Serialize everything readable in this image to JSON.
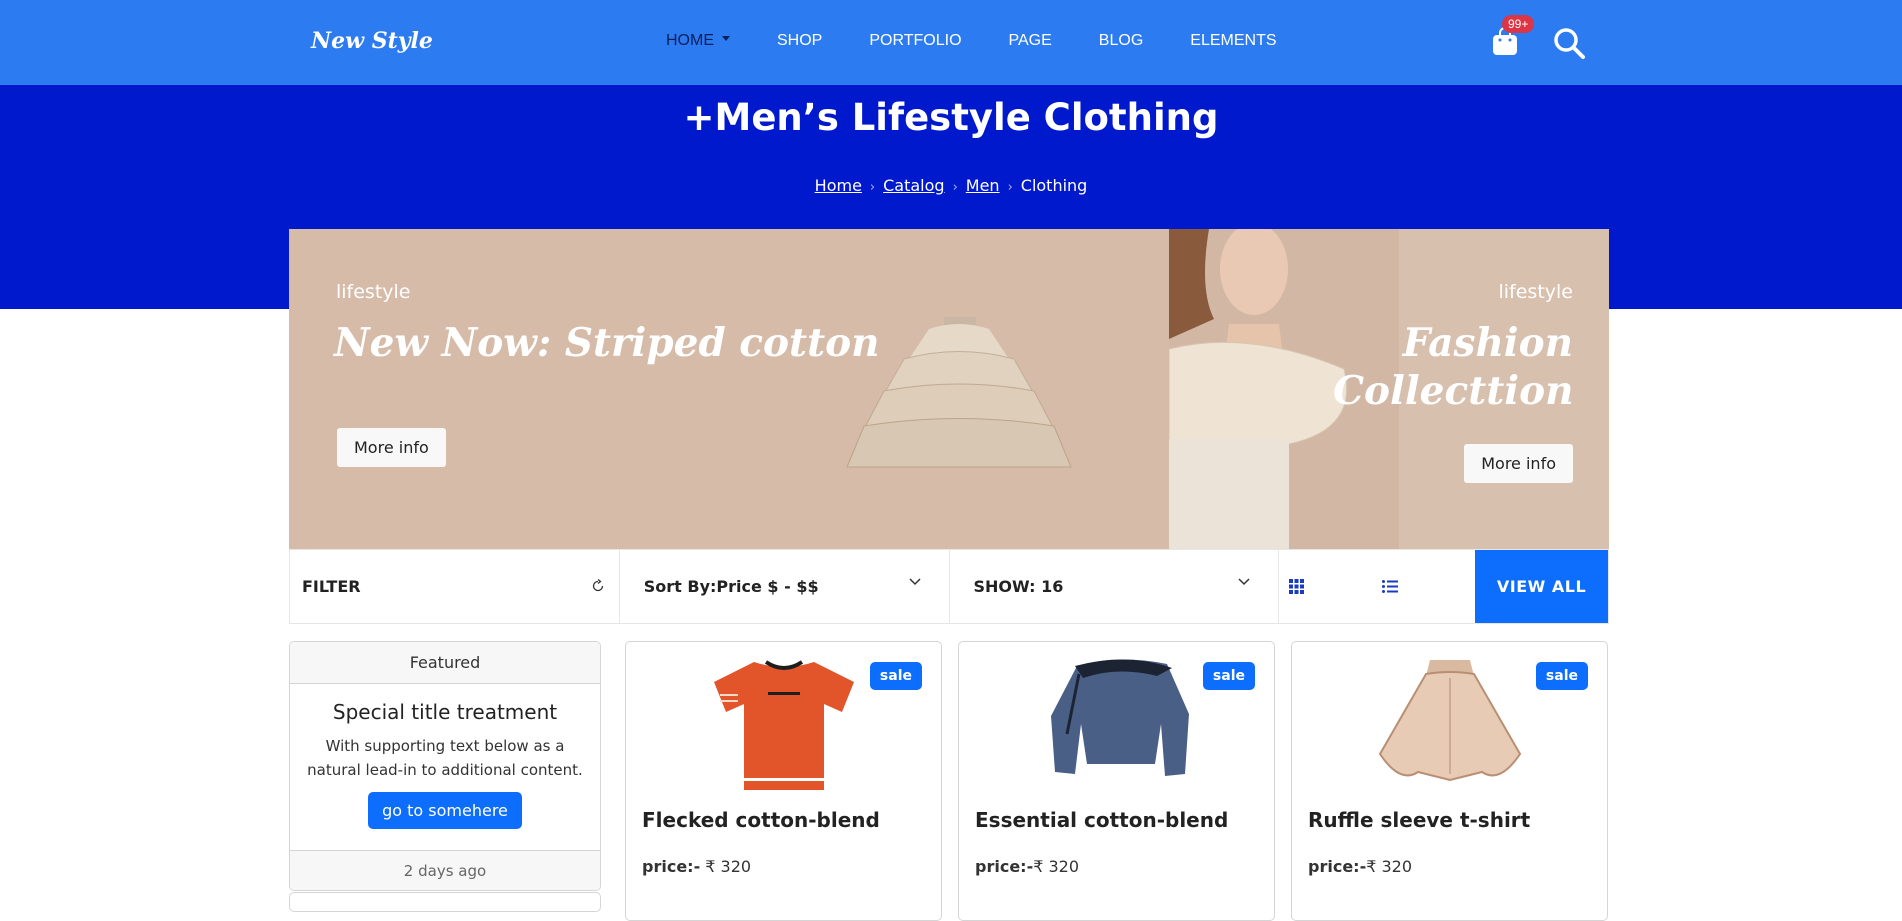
{
  "nav": {
    "brand": "New Style",
    "items": [
      {
        "label": "HOME"
      },
      {
        "label": "SHOP"
      },
      {
        "label": "PORTFOLIO"
      },
      {
        "label": "PAGE"
      },
      {
        "label": "BLOG"
      },
      {
        "label": "ELEMENTS"
      }
    ],
    "cart_badge": "99+"
  },
  "hero": {
    "title": "+Men’s Lifestyle Clothing",
    "breadcrumb": [
      "Home",
      "Catalog",
      "Men",
      "Clothing"
    ]
  },
  "banners": [
    {
      "kicker": "lifestyle",
      "heading": "New Now: Striped cotton",
      "button": "More info"
    },
    {
      "kicker": "lifestyle",
      "heading": "Fashion Collecttion",
      "button": "More info"
    }
  ],
  "toolbar": {
    "filter": "FILTER",
    "sort": "Sort By:Price $ - $$",
    "show": "SHOW: 16",
    "view_all": "VIEW ALL"
  },
  "card": {
    "header": "Featured",
    "title": "Special title treatment",
    "text": "With supporting text below as a natural lead-in to additional content.",
    "button": "go to somehere",
    "footer": "2 days ago"
  },
  "products": [
    {
      "badge": "sale",
      "name": "Flecked cotton-blend",
      "price_label": "price:-",
      "price": " ₹ 320"
    },
    {
      "badge": "sale",
      "name": "Essential cotton-blend",
      "price_label": "price:-",
      "price": "₹ 320"
    },
    {
      "badge": "sale",
      "name": "Ruffle sleeve t-shirt",
      "price_label": "price:-",
      "price": "₹ 320"
    }
  ],
  "colors": {
    "nav_bg": "#2c7bf0",
    "hero_bg": "#0019cc",
    "accent": "#0d6efd",
    "badge_red": "#dc3545"
  }
}
